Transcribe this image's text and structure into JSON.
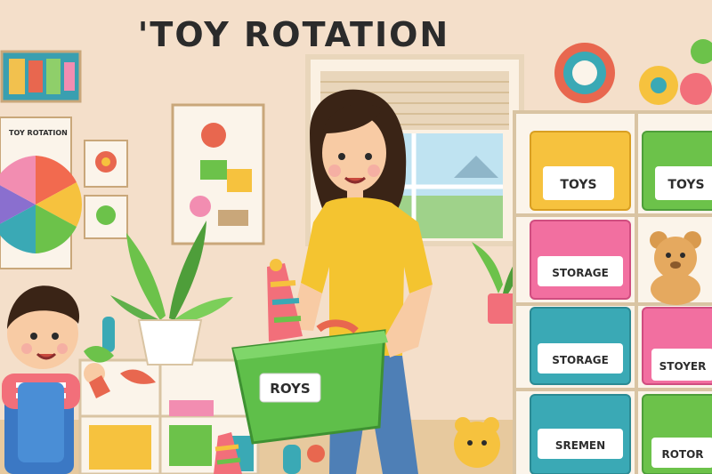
{
  "title": "'TOY ROTATION",
  "poster_caption": "TOY ROTATION",
  "bin_labels": {
    "top_left": "TOYS",
    "top_right": "TOYS",
    "mid_left": "STORAGE",
    "lower_left": "STORAGE",
    "lower_right": "STOYER",
    "bottom_left": "SREMEN",
    "bottom_right": "ROTOR"
  },
  "basket_label": "ROYS",
  "colors": {
    "wall": "#f6e3cf",
    "shirt": "#f4c430",
    "basket": "#5fbf4a",
    "bin_yellow": "#f6c23e",
    "bin_green": "#6cc24a",
    "bin_pink": "#f26fa0",
    "bin_teal": "#3aa9b5"
  }
}
